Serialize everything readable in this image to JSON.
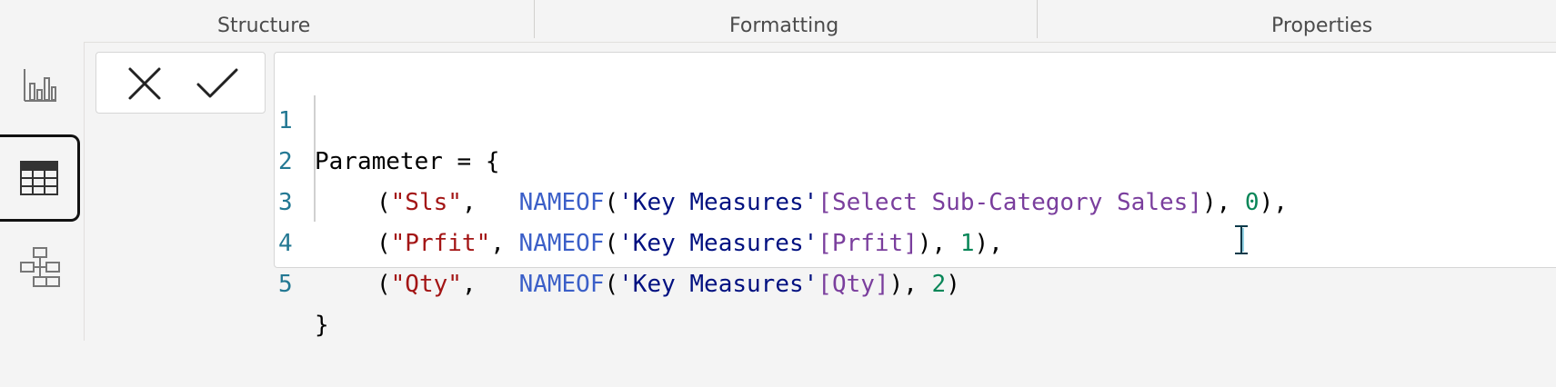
{
  "ribbon": {
    "groups": [
      "Structure",
      "Formatting",
      "Properties"
    ]
  },
  "left_nav": {
    "items": [
      {
        "name": "report-view",
        "icon": "bar-chart-icon",
        "active": false
      },
      {
        "name": "table-view",
        "icon": "table-grid-icon",
        "active": true
      },
      {
        "name": "model-view",
        "icon": "model-diagram-icon",
        "active": false
      }
    ]
  },
  "formula_bar": {
    "cancel_icon": "close-icon",
    "commit_icon": "checkmark-icon"
  },
  "editor": {
    "line_numbers": [
      "1",
      "2",
      "3",
      "4",
      "5"
    ],
    "lines": {
      "l1": {
        "a": "Parameter = {"
      },
      "l2": {
        "p1": "(",
        "s": "\"Sls\"",
        "p2": ",   ",
        "f": "NAMEOF",
        "p3": "(",
        "t": "'Key Measures'",
        "c": "[Select Sub-Category Sales]",
        "p4": "), ",
        "n": "0",
        "p5": "),"
      },
      "l3": {
        "p1": "(",
        "s": "\"Prfit\"",
        "p2": ", ",
        "f": "NAMEOF",
        "p3": "(",
        "t": "'Key Measures'",
        "c": "[Prfit]",
        "p4": "), ",
        "n": "1",
        "p5": "),"
      },
      "l4": {
        "p1": "(",
        "s": "\"Qty\"",
        "p2": ",   ",
        "f": "NAMEOF",
        "p3": "(",
        "t": "'Key Measures'",
        "c": "[Qty]",
        "p4": "), ",
        "n": "2",
        "p5": ")"
      },
      "l5": {
        "a": "}"
      }
    }
  },
  "colors": {
    "line_number": "#237893",
    "function": "#3b5fc8",
    "string": "#a31515",
    "table": "#001080",
    "column": "#7a3e9d",
    "number": "#098658"
  }
}
